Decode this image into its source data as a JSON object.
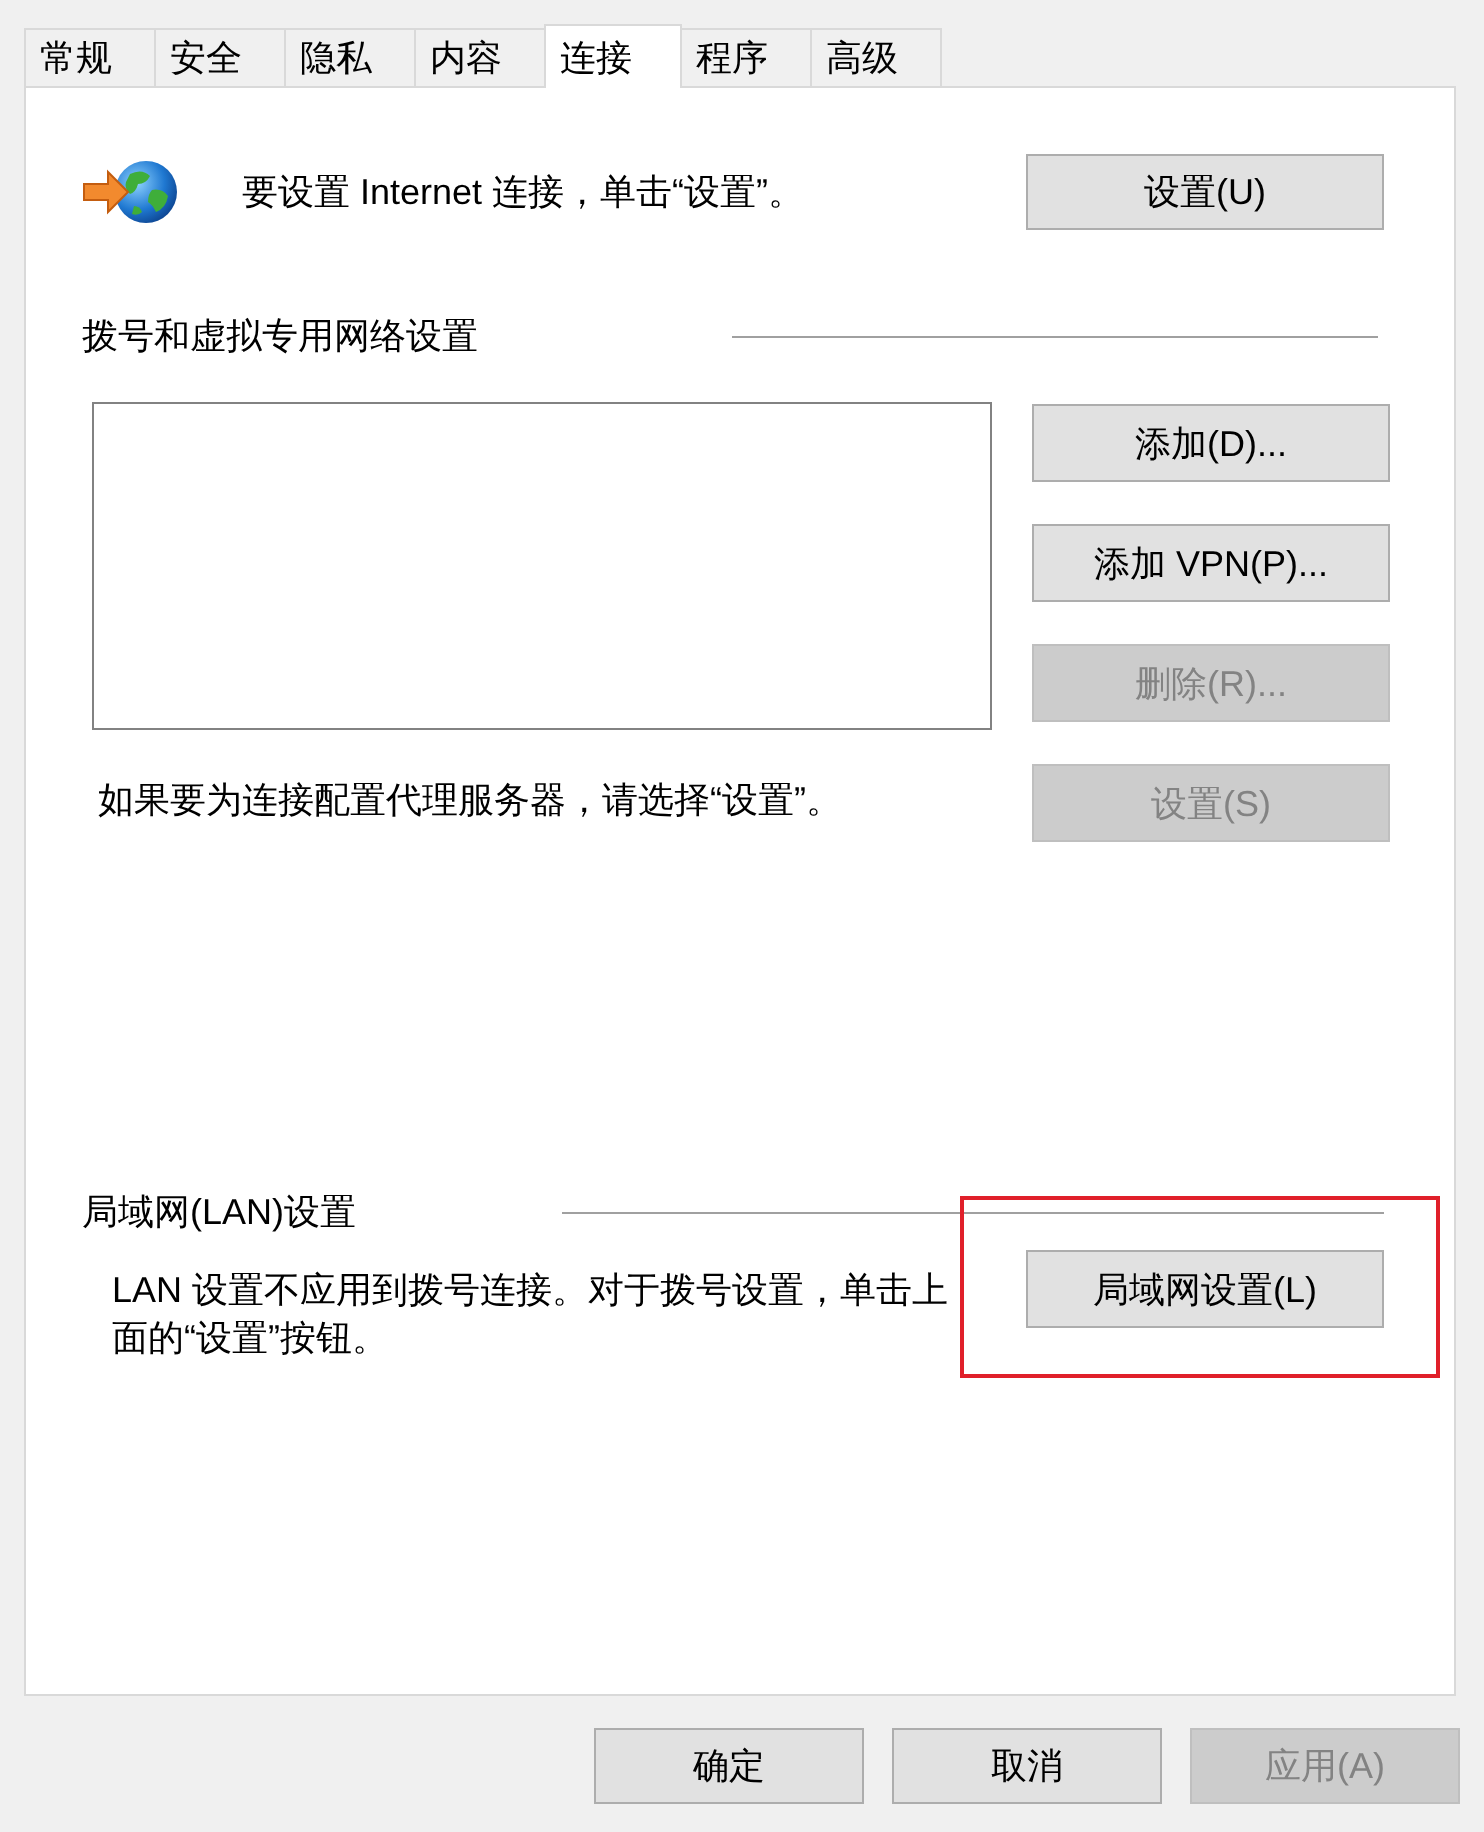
{
  "tabs": [
    {
      "label": "常规",
      "selected": false
    },
    {
      "label": "安全",
      "selected": false
    },
    {
      "label": "隐私",
      "selected": false
    },
    {
      "label": "内容",
      "selected": false
    },
    {
      "label": "连接",
      "selected": true
    },
    {
      "label": "程序",
      "selected": false
    },
    {
      "label": "高级",
      "selected": false
    }
  ],
  "internet_setup": {
    "text": "要设置 Internet 连接，单击“设置”。",
    "button": {
      "label": "设置(U)",
      "disabled": false
    }
  },
  "dialup_vpn": {
    "title": "拨号和虚拟专用网络设置",
    "buttons": [
      {
        "label": "添加(D)...",
        "disabled": false
      },
      {
        "label": "添加 VPN(P)...",
        "disabled": false
      },
      {
        "label": "删除(R)...",
        "disabled": true
      },
      {
        "label": "设置(S)",
        "disabled": true
      }
    ],
    "proxy_note": "如果要为连接配置代理服务器，请选择“设置”。"
  },
  "lan": {
    "title": "局域网(LAN)设置",
    "note": "LAN 设置不应用到拨号连接。对于拨号设置，单击上面的“设置”按钮。",
    "button": {
      "label": "局域网设置(L)",
      "disabled": false,
      "highlighted": true
    }
  },
  "footer_buttons": [
    {
      "label": "确定",
      "disabled": false
    },
    {
      "label": "取消",
      "disabled": false
    },
    {
      "label": "应用(A)",
      "disabled": true
    }
  ]
}
